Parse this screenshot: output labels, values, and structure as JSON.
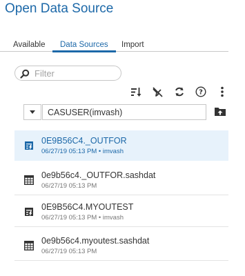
{
  "dialog": {
    "title": "Open Data Source"
  },
  "tabs": [
    {
      "label": "Available",
      "active": false
    },
    {
      "label": "Data Sources",
      "active": true
    },
    {
      "label": "Import",
      "active": false
    }
  ],
  "filter": {
    "placeholder": "Filter"
  },
  "toolbar": {
    "icons": [
      "sort-icon",
      "hide-icon",
      "refresh-icon",
      "help-icon",
      "more-vertical-icon"
    ]
  },
  "library_select": {
    "value": "CASUSER(imvash)"
  },
  "items": [
    {
      "name": "0E9B56C4._OUTFOR",
      "meta": "06/27/19 05:13 PM • imvash",
      "type": "loaded-table",
      "selected": true
    },
    {
      "name": "0e9b56c4._OUTFOR.sashdat",
      "meta": "06/27/19 05:13 PM",
      "type": "table-file",
      "selected": false
    },
    {
      "name": "0E9B56C4.MYOUTEST",
      "meta": "06/27/19 05:13 PM • imvash",
      "type": "loaded-table",
      "selected": false
    },
    {
      "name": "0e9b56c4.myoutest.sashdat",
      "meta": "06/27/19 05:13 PM",
      "type": "table-file",
      "selected": false
    }
  ],
  "colors": {
    "accent": "#1c68a8",
    "selected_bg": "#e7f2fb",
    "border": "#c6c6c6",
    "muted_text": "#767676"
  }
}
